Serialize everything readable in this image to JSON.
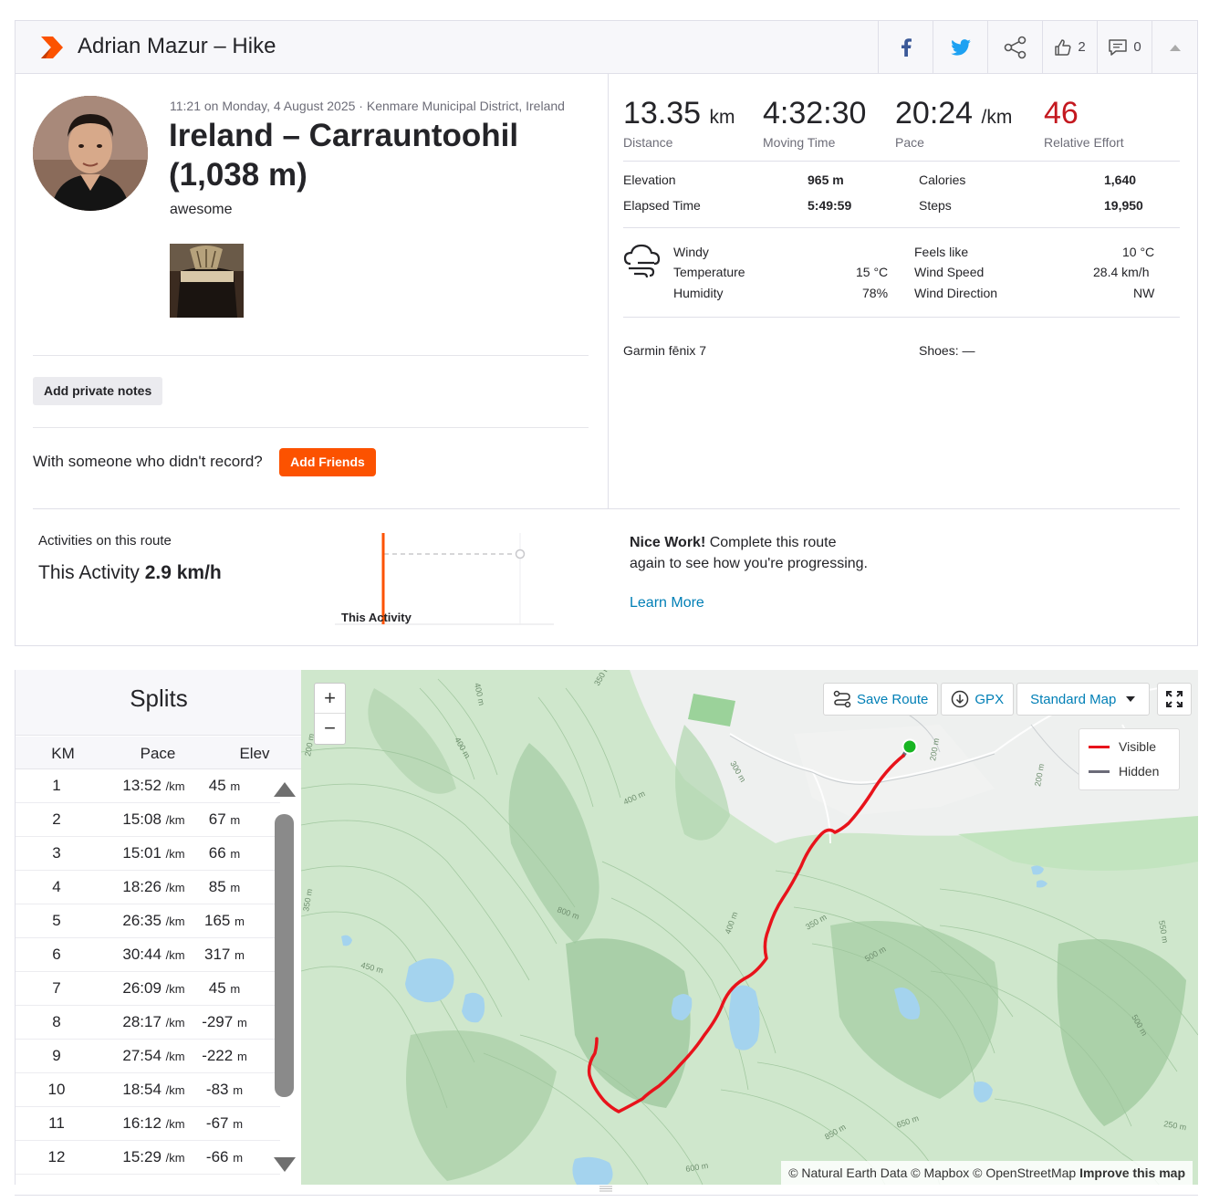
{
  "header": {
    "title": "Adrian Mazur – Hike",
    "kudos_count": "2",
    "comments_count": "0"
  },
  "activity": {
    "date_line": "11:21 on Monday, 4 August 2025 · Kenmare Municipal District, Ireland",
    "title": "Ireland – Carrauntoohil (1,038 m)",
    "description": "awesome",
    "add_notes": "Add private notes",
    "friends_question": "With someone who didn't record?",
    "add_friends": "Add Friends"
  },
  "stats": {
    "distance": {
      "value": "13.35",
      "unit": "km",
      "label": "Distance"
    },
    "moving_time": {
      "value": "4:32:30",
      "label": "Moving Time"
    },
    "pace": {
      "value": "20:24",
      "unit": "/km",
      "label": "Pace"
    },
    "relative_effort": {
      "value": "46",
      "label": "Relative Effort"
    }
  },
  "more_stats": {
    "elevation_label": "Elevation",
    "elevation_value": "965 m",
    "elapsed_label": "Elapsed Time",
    "elapsed_value": "5:49:59",
    "calories_label": "Calories",
    "calories_value": "1,640",
    "steps_label": "Steps",
    "steps_value": "19,950"
  },
  "weather": {
    "condition": "Windy",
    "temperature_label": "Temperature",
    "temperature_value": "15 °C",
    "humidity_label": "Humidity",
    "humidity_value": "78%",
    "feels_label": "Feels like",
    "feels_value": "10 °C",
    "wind_speed_label": "Wind Speed",
    "wind_speed_value": "28.4 km/h",
    "wind_dir_label": "Wind Direction",
    "wind_dir_value": "NW"
  },
  "gear": {
    "device": "Garmin fēnix 7",
    "shoes": "Shoes: —"
  },
  "route": {
    "label": "Activities on this route",
    "this_prefix": "This Activity",
    "this_speed": "2.9 km/h",
    "chart_label": "This Activity",
    "nice_bold": "Nice Work!",
    "nice_text": " Complete this route again to see how you're progressing.",
    "learn_more": "Learn More"
  },
  "splits": {
    "title": "Splits",
    "columns": [
      "KM",
      "Pace",
      "Elev"
    ],
    "pace_unit": "/km",
    "elev_unit": "m",
    "rows": [
      {
        "km": "1",
        "pace": "13:52",
        "elev": "45"
      },
      {
        "km": "2",
        "pace": "15:08",
        "elev": "67"
      },
      {
        "km": "3",
        "pace": "15:01",
        "elev": "66"
      },
      {
        "km": "4",
        "pace": "18:26",
        "elev": "85"
      },
      {
        "km": "5",
        "pace": "26:35",
        "elev": "165"
      },
      {
        "km": "6",
        "pace": "30:44",
        "elev": "317"
      },
      {
        "km": "7",
        "pace": "26:09",
        "elev": "45"
      },
      {
        "km": "8",
        "pace": "28:17",
        "elev": "-297"
      },
      {
        "km": "9",
        "pace": "27:54",
        "elev": "-222"
      },
      {
        "km": "10",
        "pace": "18:54",
        "elev": "-83"
      },
      {
        "km": "11",
        "pace": "16:12",
        "elev": "-67"
      },
      {
        "km": "12",
        "pace": "15:29",
        "elev": "-66"
      }
    ]
  },
  "map": {
    "zoom_in": "+",
    "zoom_out": "−",
    "save_route": "Save Route",
    "gpx": "GPX",
    "map_type": "Standard Map",
    "legend_visible": "Visible",
    "legend_hidden": "Hidden",
    "attribution": "© Natural Earth Data © Mapbox © OpenStreetMap",
    "improve": "Improve this map",
    "contour_labels": [
      "400 m",
      "350 m",
      "400 m",
      "300 m",
      "200 m",
      "200 m",
      "400 m",
      "800 m",
      "350 m",
      "450 m",
      "400 m",
      "350 m",
      "500 m",
      "550 m",
      "500 m",
      "250 m",
      "650 m",
      "850 m",
      "600 m",
      "200 m"
    ],
    "colors": {
      "visible": "#e8131b",
      "hidden": "#6b6b78",
      "start": "#18b522"
    }
  }
}
